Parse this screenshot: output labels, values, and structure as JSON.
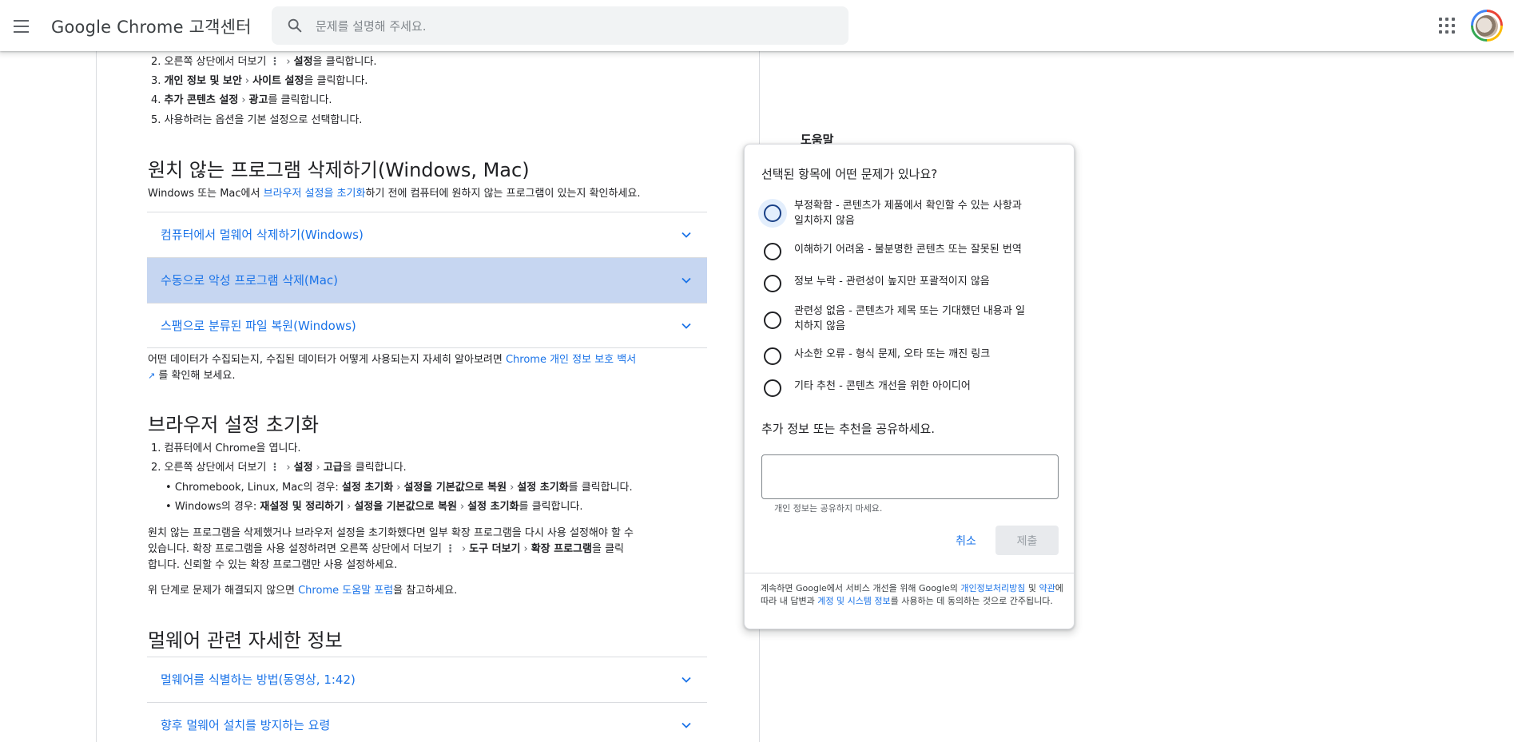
{
  "header": {
    "brand": "Google Chrome 고객센터",
    "search_placeholder": "문제를 설명해 주세요."
  },
  "article": {
    "steps_top": {
      "s2_prefix": "2. 오른쪽 상단에서 더보기",
      "s2_b": "설정",
      "s2_suffix": "을 클릭합니다.",
      "s3_b1": "개인 정보 및 보안",
      "s3_b2": "사이트 설정",
      "s3_suffix": "을 클릭합니다.",
      "s4_b1": "추가 콘텐츠 설정",
      "s4_b2": "광고",
      "s4_suffix": "를 클릭합니다.",
      "s5": "5. 사용하려는 옵션을 기본 설정으로 선택합니다."
    },
    "sec_remove": {
      "title": "원치 않는 프로그램 삭제하기(Windows, Mac)",
      "desc_prefix": "Windows 또는 Mac에서 ",
      "desc_link": "브라우저 설정을 초기화",
      "desc_suffix": "하기 전에 컴퓨터에 원하지 않는 프로그램이 있는지 확인하세요."
    },
    "accordions_1": [
      {
        "title": "컴퓨터에서 멀웨어 삭제하기(Windows)"
      },
      {
        "title": "수동으로 악성 프로그램 삭제(Mac)"
      },
      {
        "title": "스팸으로 분류된 파일 복원(Windows)"
      }
    ],
    "privacy_note": {
      "prefix": "어떤 데이터가 수집되는지, 수집된 데이터가 어떻게 사용되는지 자세히 알아보려면 ",
      "link": "Chrome 개인 정보 보호 백서",
      "suffix": "를 확인해 보세요."
    },
    "sec_reset": {
      "title": "브라우저 설정 초기화",
      "s1": "1. 컴퓨터에서 Chrome을 엽니다.",
      "s2_prefix": "2. 오른쪽 상단에서 더보기",
      "s2_b1": "설정",
      "s2_b2": "고급",
      "s2_suffix": "을 클릭합니다.",
      "b1_prefix": "Chromebook, Linux, Mac의 경우: ",
      "b1_b1": "설정 초기화",
      "b1_b2": "설정을 기본값으로 복원",
      "b1_b3": "설정 초기화",
      "b1_suffix": "를 클릭합니다.",
      "b2_prefix": "Windows의 경우: ",
      "b2_b1": "재설정 및 정리하기",
      "b2_b2": "설정을 기본값으로 복원",
      "b2_b3": "설정 초기화",
      "b2_suffix": "를 클릭합니다.",
      "p1_l1": "원치 않는 프로그램을 삭제했거나 브라우저 설정을 초기화했다면 일부 확장 프로그램을 다시 사용 설정해야 할 수",
      "p1_l2_prefix": "있습니다. 확장 프로그램을 사용 설정하려면 오른쪽 상단에서 더보기",
      "p1_l2_b1": "도구 더보기",
      "p1_l2_b2": "확장 프로그램",
      "p1_l2_suffix": "을 클릭",
      "p1_l3": "합니다. 신뢰할 수 있는 확장 프로그램만 사용 설정하세요.",
      "p2_prefix": "위 단계로 문제가 해결되지 않으면 ",
      "p2_link": "Chrome 도움말 포럼",
      "p2_suffix": "을 참고하세요."
    },
    "sec_more": {
      "title": "멀웨어 관련 자세한 정보"
    },
    "accordions_2": [
      {
        "title": "멀웨어를 식별하는 방법(동영상, 1:42)"
      },
      {
        "title": "향후 멀웨어 설치를 방지하는 요령"
      }
    ]
  },
  "sidebar": {
    "help_label": "도움말"
  },
  "feedback": {
    "question": "선택된 항목에 어떤 문제가 있나요?",
    "options": [
      {
        "line1": "부정확함 - 콘텐츠가 제품에서 확인할 수 있는 사항과",
        "line2": "일치하지 않음"
      },
      {
        "line1": "이해하기 어려움 - 불분명한 콘텐츠 또는 잘못된 번역",
        "line2": ""
      },
      {
        "line1": "정보 누락 - 관련성이 높지만 포괄적이지 않음",
        "line2": ""
      },
      {
        "line1": "관련성 없음 - 콘텐츠가 제목 또는 기대했던 내용과 일",
        "line2": "치하지 않음"
      },
      {
        "line1": "사소한 오류 - 형식 문제, 오타 또는 깨진 링크",
        "line2": ""
      },
      {
        "line1": "기타 추천 - 콘텐츠 개선을 위한 아이디어",
        "line2": ""
      }
    ],
    "share_label": "추가 정보 또는 추천을 공유하세요.",
    "textarea_value": "",
    "hint": "개인 정보는 공유하지 마세요.",
    "cancel_label": "취소",
    "submit_label": "제출",
    "footer": {
      "t1": "계속하면 Google에서 서비스 개선을 위해 Google의 ",
      "link1": "개인정보처리방침",
      "t2": " 및 ",
      "link2": "약관",
      "t3": "에 따라 내 답변과 ",
      "link3": "계정 및 시스템 정보",
      "t4": "를 사용하는 데 동의하는 것으로 간주됩니다."
    }
  },
  "colors": {
    "link": "#1a73e8",
    "accordion_active": "#c6d6f1",
    "divider": "#dadce0"
  }
}
